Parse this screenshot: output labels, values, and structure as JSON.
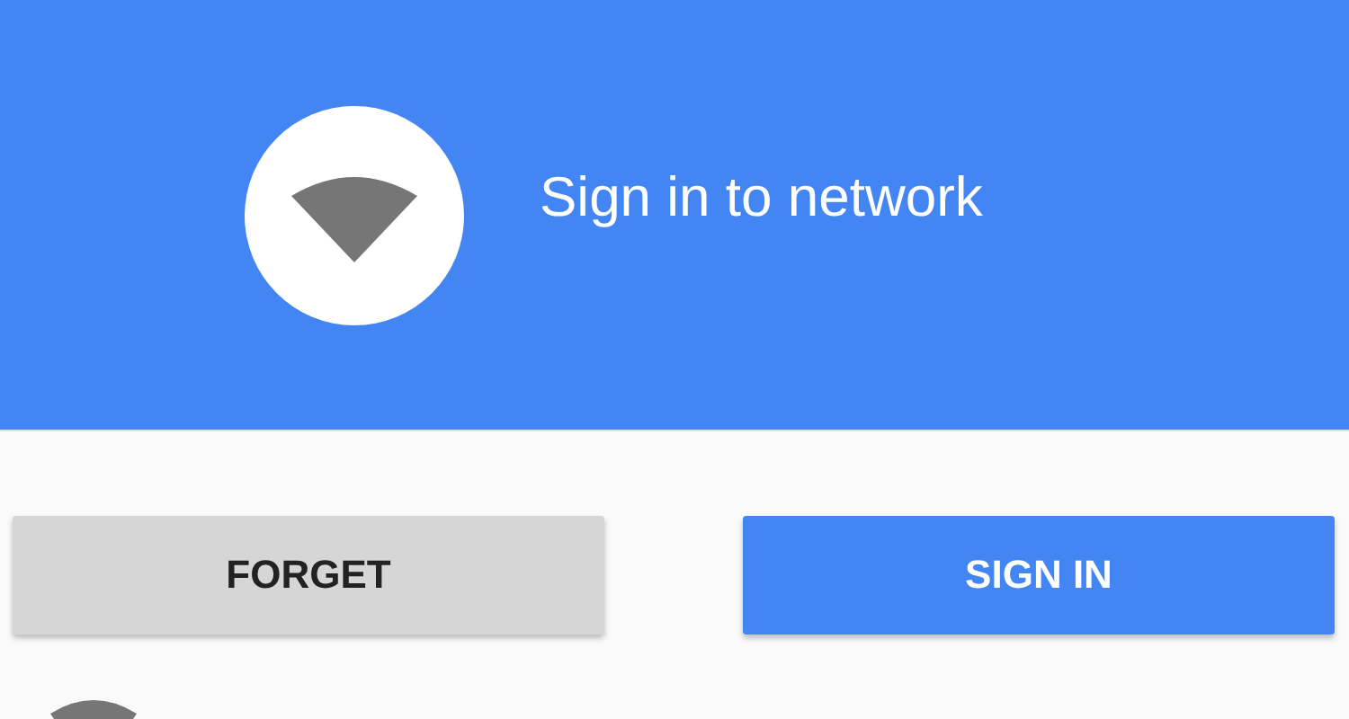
{
  "header": {
    "title": "Sign in to network"
  },
  "buttons": [
    {
      "label": "FORGET",
      "kind": "secondary"
    },
    {
      "label": "SIGN IN",
      "kind": "primary"
    }
  ]
}
